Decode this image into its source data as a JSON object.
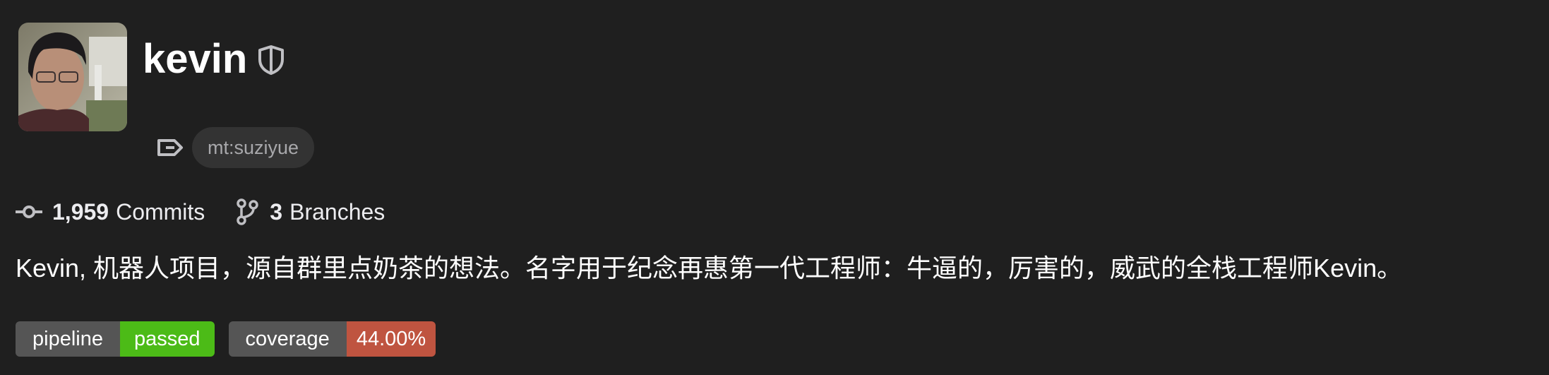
{
  "project": {
    "title": "kevin",
    "topic_icon": "label-icon",
    "topic": "mt:suziyue",
    "visibility_icon": "shield-icon"
  },
  "stats": {
    "commits_icon": "commit-icon",
    "commits_count": "1,959",
    "commits_label": "Commits",
    "branches_icon": "branch-icon",
    "branches_count": "3",
    "branches_label": "Branches"
  },
  "description": "Kevin, 机器人项目，源自群里点奶茶的想法。名字用于纪念再惠第一代工程师：牛逼的，厉害的，威武的全栈工程师Kevin。",
  "badges": [
    {
      "label": "pipeline",
      "value": "passed",
      "color": "#4cbb17"
    },
    {
      "label": "coverage",
      "value": "44.00%",
      "color": "#bf5440"
    }
  ],
  "colors": {
    "background": "#1f1f1f",
    "pill": "#333333",
    "badge_label": "#555555"
  }
}
